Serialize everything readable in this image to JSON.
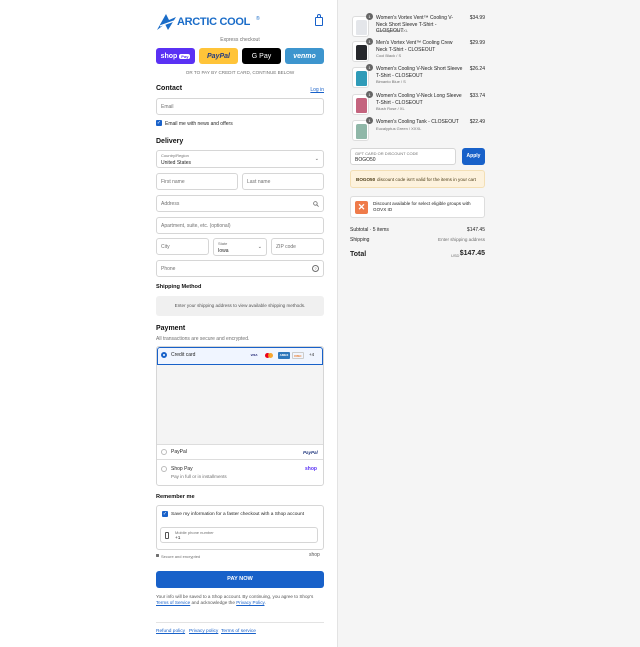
{
  "brand": {
    "name": "ARCTIC COOL",
    "trademark": "®"
  },
  "express": {
    "label": "Express checkout",
    "shop_pay": "shop",
    "shop_pay_badge": "Pay",
    "paypal": "PayPal",
    "gpay": "G Pay",
    "venmo": "venmo",
    "divider": "OR TO PAY BY CREDIT CARD, CONTINUE BELOW"
  },
  "contact": {
    "title": "Contact",
    "login": "Log in",
    "email_placeholder": "Email",
    "news_label": "Email me with news and offers"
  },
  "delivery": {
    "title": "Delivery",
    "country_label": "Country/Region",
    "country_value": "United States",
    "first_name": "First name",
    "last_name": "Last name",
    "address": "Address",
    "apartment": "Apartment, suite, etc. (optional)",
    "city": "City",
    "state_label": "State",
    "state_value": "Iowa",
    "zip": "ZIP code",
    "phone": "Phone"
  },
  "shipping": {
    "title": "Shipping Method",
    "note": "Enter your shipping address to view available shipping methods."
  },
  "payment": {
    "title": "Payment",
    "subtitle": "All transactions are secure and encrypted.",
    "credit_card": "Credit card",
    "card_logos": [
      "VISA",
      "MC",
      "AMEX",
      "DISC"
    ],
    "more_cards": "+4",
    "paypal": "PayPal",
    "paypal_logo": "PayPal",
    "shop_pay": "Shop Pay",
    "shop_pay_sub": "Pay in full or in installments",
    "shop_logo": "shop"
  },
  "remember": {
    "title": "Remember me",
    "save_label": "Save my information for a faster checkout with a Shop account",
    "mobile_label": "Mobile phone number",
    "mobile_value": "+1",
    "secure": "Secure and encrypted",
    "shop_logo": "shop"
  },
  "pay_now": "PAY NOW",
  "legal": {
    "text_a": "Your info will be saved to a Shop account. By continuing, you agree to Shop's",
    "terms": "Terms of Service",
    "text_b": "and acknowledge the",
    "privacy": "Privacy Policy",
    "text_c": "."
  },
  "footer": [
    "Refund policy",
    "Privacy policy",
    "Terms of service"
  ],
  "cart": {
    "items": [
      {
        "qty": "1",
        "name": "Women's Vortex Vent™ Cooling V-Neck Short Sleeve T-Shirt - CLOSEOUT",
        "variant": "Morning Rain / XL",
        "price": "$34.99",
        "color": "#e4e6ea"
      },
      {
        "qty": "1",
        "name": "Men's Vortex Vent™ Cooling Crew Neck T-Shirt - CLOSEOUT",
        "variant": "Cool Black / S",
        "price": "$29.99",
        "color": "#26282c"
      },
      {
        "qty": "1",
        "name": "Women's Cooling V-Neck Short Sleeve T-Shirt - CLOSEOUT",
        "variant": "Bimanto Blue / S",
        "price": "$26.24",
        "color": "#2f9bb8"
      },
      {
        "qty": "1",
        "name": "Women's Cooling V-Neck Long Sleeve T-Shirt - CLOSEOUT",
        "variant": "Blush Rose / XL",
        "price": "$33.74",
        "color": "#c4647e"
      },
      {
        "qty": "1",
        "name": "Women's Cooling Tank - CLOSEOUT",
        "variant": "Eucalyptus Green / XXXL",
        "price": "$22.49",
        "color": "#8fb7a8"
      }
    ],
    "discount_label": "GIFT CARD OR DISCOUNT CODE",
    "discount_value": "BOGO50",
    "apply": "Apply",
    "warn_code": "BOGO50",
    "warn_text": "discount code isn't valid for the items in your cart",
    "govx_text": "Discount available for select eligible groups with GOVX ID",
    "subtotal_label": "Subtotal · 5 items",
    "subtotal": "$147.45",
    "shipping_label": "Shipping",
    "shipping_value": "Enter shipping address",
    "total_label": "Total",
    "currency": "USD",
    "total": "$147.45"
  },
  "colors": {
    "accent": "#1861c9",
    "brand": "#1a6cc8",
    "warn_bg": "#fdf2dd"
  }
}
